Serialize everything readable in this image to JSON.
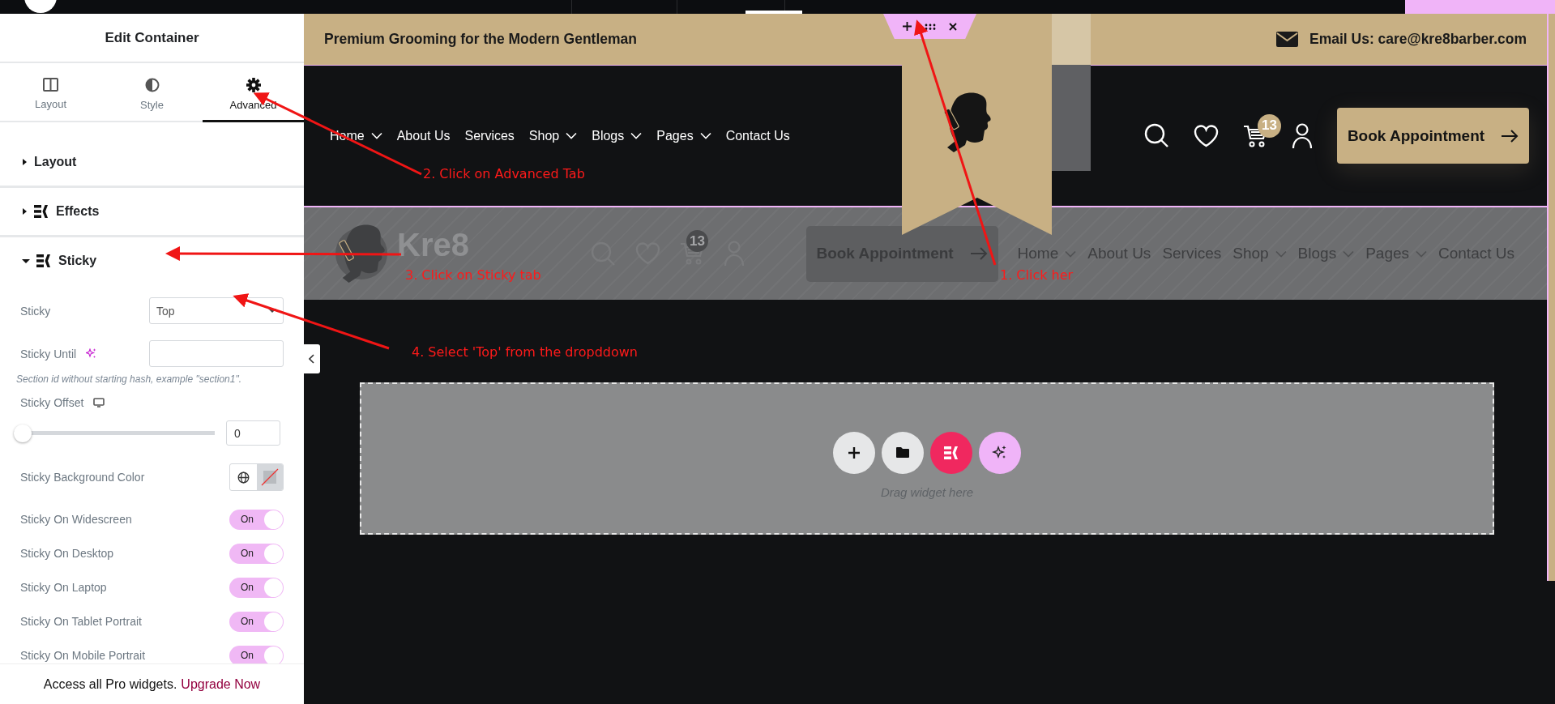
{
  "editor_panel": {
    "title": "Edit Container",
    "tabs": [
      {
        "label": "Layout",
        "selected": false
      },
      {
        "label": "Style",
        "selected": false
      },
      {
        "label": "Advanced",
        "selected": true
      }
    ],
    "sections": [
      {
        "title": "Layout",
        "expanded": false,
        "pro": false
      },
      {
        "title": "Effects",
        "expanded": false,
        "pro": true
      },
      {
        "title": "Sticky",
        "expanded": true,
        "pro": true
      }
    ],
    "controls": [
      {
        "kind": "select",
        "label": "Sticky",
        "value": "Top"
      },
      {
        "kind": "text",
        "label": "Sticky Until",
        "ai": true
      },
      {
        "kind": "hint",
        "text": "Section id without starting hash, example \"section1\"."
      },
      {
        "kind": "slider",
        "label": "Sticky Offset",
        "responsive": true,
        "level": 0,
        "value": "0"
      },
      {
        "kind": "color",
        "label": "Sticky Background Color"
      },
      {
        "kind": "toggle",
        "label": "Sticky On Widescreen",
        "on": true,
        "state": "On"
      },
      {
        "kind": "toggle",
        "label": "Sticky On Desktop",
        "on": true,
        "state": "On"
      },
      {
        "kind": "toggle",
        "label": "Sticky On Laptop",
        "on": true,
        "state": "On"
      },
      {
        "kind": "toggle",
        "label": "Sticky On Tablet Portrait",
        "on": true,
        "state": "On"
      },
      {
        "kind": "toggle",
        "label": "Sticky On Mobile Portrait",
        "on": true,
        "state": "On"
      }
    ],
    "promo": {
      "text": "Access all Pro widgets.",
      "link": "Upgrade Now"
    }
  },
  "canvas": {
    "top_bar": {
      "tagline": "Premium Grooming for the Modern Gentleman",
      "email": "Email Us: care@kre8barber.com"
    },
    "header": {
      "nav": [
        {
          "label": "Home",
          "dropdown": true
        },
        {
          "label": "About Us",
          "dropdown": false
        },
        {
          "label": "Services",
          "dropdown": false
        },
        {
          "label": "Shop",
          "dropdown": true
        },
        {
          "label": "Blogs",
          "dropdown": true
        },
        {
          "label": "Pages",
          "dropdown": true
        },
        {
          "label": "Contact Us",
          "dropdown": false
        }
      ],
      "cart_count": "13",
      "button": "Book Appointment"
    },
    "sticky_preview": {
      "logo_text": "Kre8",
      "cart_count": "13",
      "button": "Book Appointment",
      "nav": [
        {
          "label": "Home",
          "dropdown": true
        },
        {
          "label": "About Us",
          "dropdown": false
        },
        {
          "label": "Services",
          "dropdown": false
        },
        {
          "label": "Shop",
          "dropdown": true
        },
        {
          "label": "Blogs",
          "dropdown": true
        },
        {
          "label": "Pages",
          "dropdown": true
        },
        {
          "label": "Contact Us",
          "dropdown": false
        }
      ]
    },
    "drop_zone": {
      "hint": "Drag widget here"
    }
  },
  "annotations": [
    {
      "text": "1. Click her"
    },
    {
      "text": "2. Click on Advanced Tab"
    },
    {
      "text": "3. Click on  Sticky tab"
    },
    {
      "text": "4. Select 'Top' from the dropddown"
    }
  ]
}
